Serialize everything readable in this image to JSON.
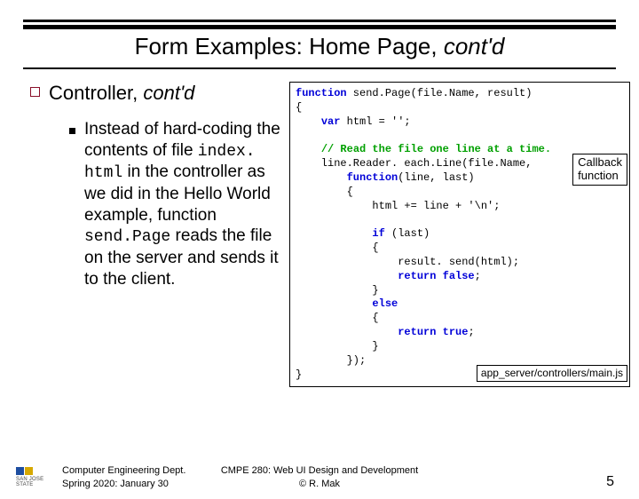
{
  "title_main": "Form Examples: Home Page, ",
  "title_em": "cont'd",
  "h2_main": "Controller, ",
  "h2_em": "cont'd",
  "body_p1": "Instead of hard-coding the contents of file ",
  "body_code1": "index. html",
  "body_p2": " in the controller as we did in the Hello World example, function ",
  "body_code2": "send.Page",
  "body_p3": " reads the file on the server and sends it to the client.",
  "callout_cb1": "Callback",
  "callout_cb2": "function",
  "callout_path": "app_server/controllers/main.js",
  "code": {
    "l1a": "function",
    "l1b": " send.Page(file.Name, result)",
    "l2": "{",
    "l3a": "    ",
    "l3b": "var",
    "l3c": " html = '';",
    "l4": "",
    "l5a": "    ",
    "l5b": "// Read the file one line at a time.",
    "l6": "    line.Reader. each.Line(file.Name,",
    "l7a": "        ",
    "l7b": "function",
    "l7c": "(line, last)",
    "l8": "        {",
    "l9": "            html += line + '\\n';",
    "l10": "",
    "l11a": "            ",
    "l11b": "if",
    "l11c": " (last)",
    "l12": "            {",
    "l13": "                result. send(html);",
    "l14a": "                ",
    "l14b": "return false",
    "l14c": ";",
    "l15": "            }",
    "l16a": "            ",
    "l16b": "else",
    "l17": "            {",
    "l18a": "                ",
    "l18b": "return true",
    "l18c": ";",
    "l19": "            }",
    "l20": "        });",
    "l21": "}"
  },
  "footer_left1": "Computer Engineering Dept.",
  "footer_left2": "Spring 2020: January 30",
  "footer_mid1": "CMPE 280: Web UI Design and Development",
  "footer_mid2": "© R. Mak",
  "footer_right": "5",
  "logo_txt": "SAN JOSE STATE"
}
